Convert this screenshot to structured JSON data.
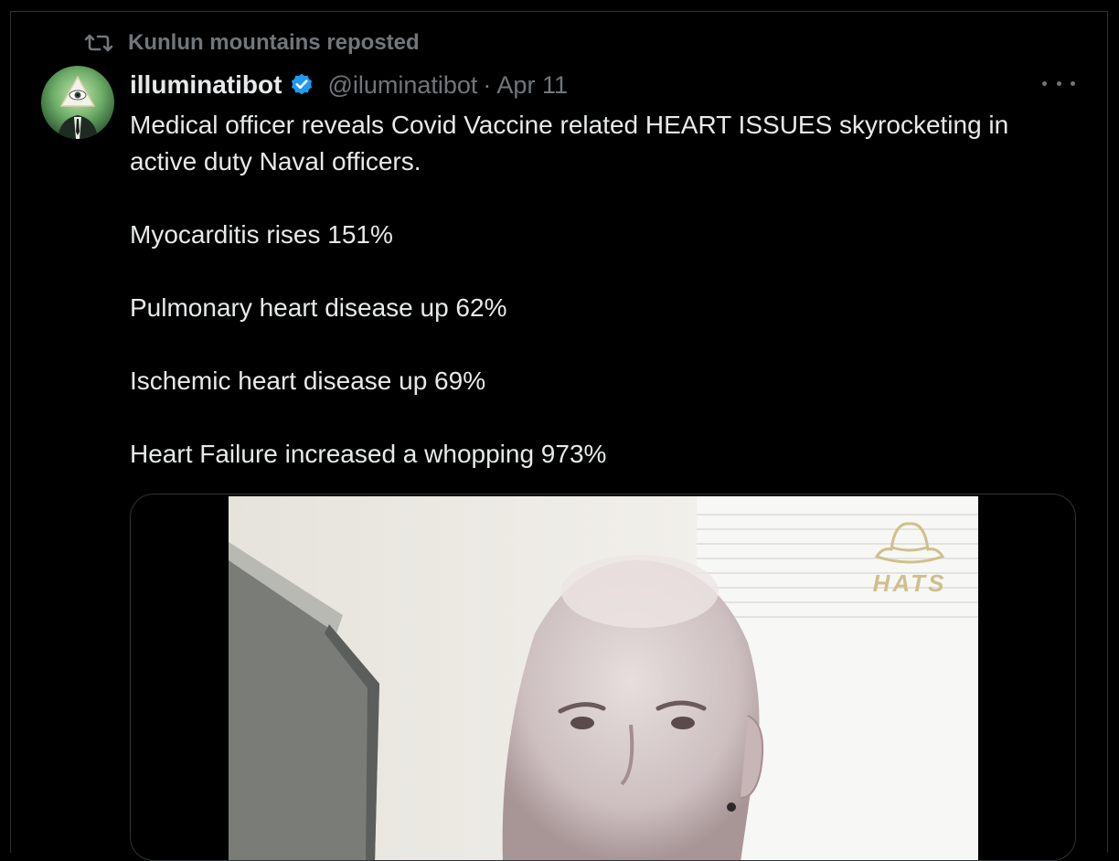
{
  "repost": {
    "label": "Kunlun mountains reposted"
  },
  "author": {
    "name": "illuminatibot",
    "handle": "@iluminatibot",
    "separator": "·",
    "date": "Apr 11",
    "verified": true
  },
  "tweet": {
    "lines": [
      "Medical officer reveals Covid Vaccine related HEART ISSUES skyrocketing in active duty Naval officers.",
      "Myocarditis rises 151%",
      "Pulmonary heart disease up 62%",
      "Ischemic heart disease up 69%",
      "Heart Failure increased a whopping 973%"
    ]
  },
  "media": {
    "watermark": "HATS"
  },
  "icons": {
    "repost": "repost-icon",
    "verified": "verified-badge-icon",
    "more": "more-options-icon"
  },
  "colors": {
    "background": "#000000",
    "text": "#e7e9ea",
    "muted": "#71767b",
    "verified": "#1d9bf0",
    "border": "#2f3336"
  }
}
